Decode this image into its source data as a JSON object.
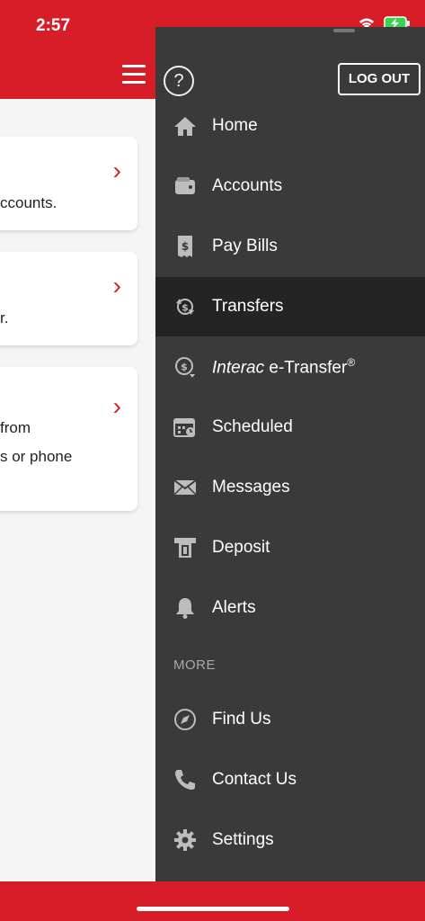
{
  "status_bar": {
    "time": "2:57"
  },
  "cards": [
    {
      "line1": "ccounts."
    },
    {
      "line1": "r."
    },
    {
      "line1": " from",
      "line2": "s or phone"
    }
  ],
  "drawer": {
    "help_symbol": "?",
    "logout_label": "LOG OUT",
    "items": [
      {
        "label": "Home"
      },
      {
        "label": "Accounts"
      },
      {
        "label": "Pay Bills"
      },
      {
        "label": "Transfers"
      },
      {
        "label_italic": "Interac",
        "label_rest": " e-Transfer",
        "label_sup": "®"
      },
      {
        "label": "Scheduled"
      },
      {
        "label": "Messages"
      },
      {
        "label": "Deposit"
      },
      {
        "label": "Alerts"
      }
    ],
    "more_label": "MORE",
    "more_items": [
      {
        "label": "Find Us"
      },
      {
        "label": "Contact Us"
      },
      {
        "label": "Settings"
      }
    ]
  },
  "colors": {
    "brand": "#d71e28",
    "drawer_bg": "#3a3a3a",
    "drawer_active": "#242424",
    "icon": "#bdbdbd"
  }
}
